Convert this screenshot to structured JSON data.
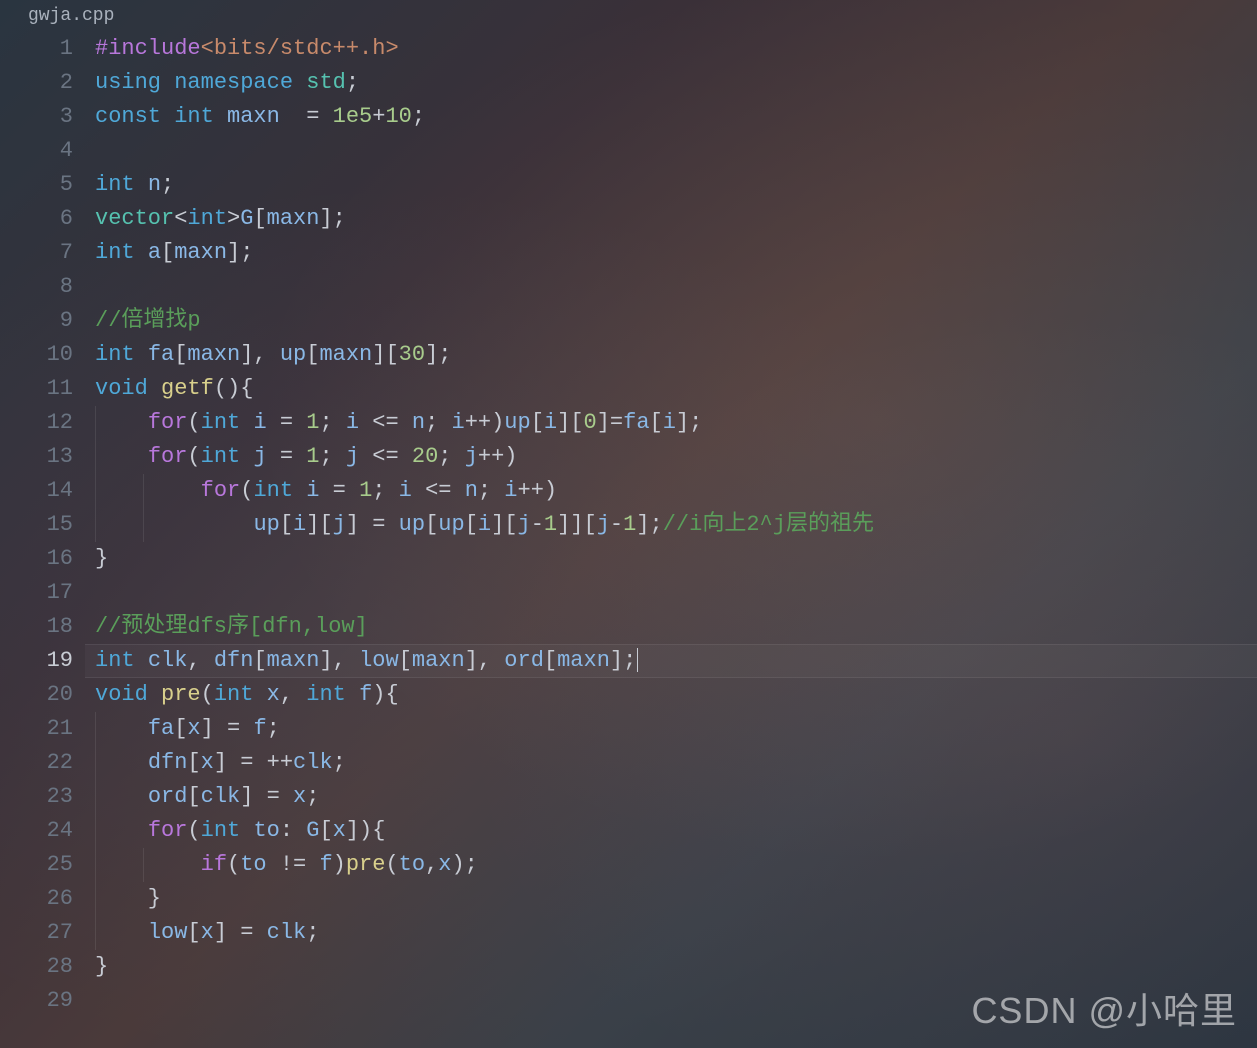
{
  "tab": {
    "filename": "gwja.cpp"
  },
  "active_line": 19,
  "gutter": {
    "start": 1,
    "end": 29
  },
  "code": {
    "lines": [
      [
        {
          "t": "#include",
          "c": "kw-purple"
        },
        {
          "t": "<bits/stdc++.h>",
          "c": "string"
        }
      ],
      [
        {
          "t": "using",
          "c": "kw-blue"
        },
        {
          "t": " ",
          "c": ""
        },
        {
          "t": "namespace",
          "c": "kw-blue"
        },
        {
          "t": " ",
          "c": ""
        },
        {
          "t": "std",
          "c": "kw-teal"
        },
        {
          "t": ";",
          "c": "punct"
        }
      ],
      [
        {
          "t": "const",
          "c": "kw-blue"
        },
        {
          "t": " ",
          "c": ""
        },
        {
          "t": "int",
          "c": "kw-blue"
        },
        {
          "t": " ",
          "c": ""
        },
        {
          "t": "maxn",
          "c": "var"
        },
        {
          "t": "  = ",
          "c": "op"
        },
        {
          "t": "1e5",
          "c": "num-green"
        },
        {
          "t": "+",
          "c": "op"
        },
        {
          "t": "10",
          "c": "num-green"
        },
        {
          "t": ";",
          "c": "punct"
        }
      ],
      [],
      [
        {
          "t": "int",
          "c": "kw-blue"
        },
        {
          "t": " ",
          "c": ""
        },
        {
          "t": "n",
          "c": "var"
        },
        {
          "t": ";",
          "c": "punct"
        }
      ],
      [
        {
          "t": "vector",
          "c": "kw-teal"
        },
        {
          "t": "<",
          "c": "punct"
        },
        {
          "t": "int",
          "c": "kw-blue"
        },
        {
          "t": ">",
          "c": "punct"
        },
        {
          "t": "G",
          "c": "var"
        },
        {
          "t": "[",
          "c": "punct"
        },
        {
          "t": "maxn",
          "c": "var"
        },
        {
          "t": "];",
          "c": "punct"
        }
      ],
      [
        {
          "t": "int",
          "c": "kw-blue"
        },
        {
          "t": " ",
          "c": ""
        },
        {
          "t": "a",
          "c": "var"
        },
        {
          "t": "[",
          "c": "punct"
        },
        {
          "t": "maxn",
          "c": "var"
        },
        {
          "t": "];",
          "c": "punct"
        }
      ],
      [],
      [
        {
          "t": "//倍增找p",
          "c": "comment"
        }
      ],
      [
        {
          "t": "int",
          "c": "kw-blue"
        },
        {
          "t": " ",
          "c": ""
        },
        {
          "t": "fa",
          "c": "var"
        },
        {
          "t": "[",
          "c": "punct"
        },
        {
          "t": "maxn",
          "c": "var"
        },
        {
          "t": "], ",
          "c": "punct"
        },
        {
          "t": "up",
          "c": "var"
        },
        {
          "t": "[",
          "c": "punct"
        },
        {
          "t": "maxn",
          "c": "var"
        },
        {
          "t": "][",
          "c": "punct"
        },
        {
          "t": "30",
          "c": "num-green"
        },
        {
          "t": "];",
          "c": "punct"
        }
      ],
      [
        {
          "t": "void",
          "c": "kw-blue"
        },
        {
          "t": " ",
          "c": ""
        },
        {
          "t": "getf",
          "c": "fn-yellow"
        },
        {
          "t": "(){",
          "c": "punct"
        }
      ],
      [
        {
          "t": "    ",
          "c": ""
        },
        {
          "t": "for",
          "c": "kw-purple"
        },
        {
          "t": "(",
          "c": "punct"
        },
        {
          "t": "int",
          "c": "kw-blue"
        },
        {
          "t": " ",
          "c": ""
        },
        {
          "t": "i",
          "c": "var"
        },
        {
          "t": " = ",
          "c": "op"
        },
        {
          "t": "1",
          "c": "num-green"
        },
        {
          "t": "; ",
          "c": "punct"
        },
        {
          "t": "i",
          "c": "var"
        },
        {
          "t": " <= ",
          "c": "op"
        },
        {
          "t": "n",
          "c": "var"
        },
        {
          "t": "; ",
          "c": "punct"
        },
        {
          "t": "i",
          "c": "var"
        },
        {
          "t": "++)",
          "c": "punct"
        },
        {
          "t": "up",
          "c": "var"
        },
        {
          "t": "[",
          "c": "punct"
        },
        {
          "t": "i",
          "c": "var"
        },
        {
          "t": "][",
          "c": "punct"
        },
        {
          "t": "0",
          "c": "num-green"
        },
        {
          "t": "]=",
          "c": "punct"
        },
        {
          "t": "fa",
          "c": "var"
        },
        {
          "t": "[",
          "c": "punct"
        },
        {
          "t": "i",
          "c": "var"
        },
        {
          "t": "];",
          "c": "punct"
        }
      ],
      [
        {
          "t": "    ",
          "c": ""
        },
        {
          "t": "for",
          "c": "kw-purple"
        },
        {
          "t": "(",
          "c": "punct"
        },
        {
          "t": "int",
          "c": "kw-blue"
        },
        {
          "t": " ",
          "c": ""
        },
        {
          "t": "j",
          "c": "var"
        },
        {
          "t": " = ",
          "c": "op"
        },
        {
          "t": "1",
          "c": "num-green"
        },
        {
          "t": "; ",
          "c": "punct"
        },
        {
          "t": "j",
          "c": "var"
        },
        {
          "t": " <= ",
          "c": "op"
        },
        {
          "t": "20",
          "c": "num-green"
        },
        {
          "t": "; ",
          "c": "punct"
        },
        {
          "t": "j",
          "c": "var"
        },
        {
          "t": "++)",
          "c": "punct"
        }
      ],
      [
        {
          "t": "        ",
          "c": ""
        },
        {
          "t": "for",
          "c": "kw-purple"
        },
        {
          "t": "(",
          "c": "punct"
        },
        {
          "t": "int",
          "c": "kw-blue"
        },
        {
          "t": " ",
          "c": ""
        },
        {
          "t": "i",
          "c": "var"
        },
        {
          "t": " = ",
          "c": "op"
        },
        {
          "t": "1",
          "c": "num-green"
        },
        {
          "t": "; ",
          "c": "punct"
        },
        {
          "t": "i",
          "c": "var"
        },
        {
          "t": " <= ",
          "c": "op"
        },
        {
          "t": "n",
          "c": "var"
        },
        {
          "t": "; ",
          "c": "punct"
        },
        {
          "t": "i",
          "c": "var"
        },
        {
          "t": "++)",
          "c": "punct"
        }
      ],
      [
        {
          "t": "            ",
          "c": ""
        },
        {
          "t": "up",
          "c": "var"
        },
        {
          "t": "[",
          "c": "punct"
        },
        {
          "t": "i",
          "c": "var"
        },
        {
          "t": "][",
          "c": "punct"
        },
        {
          "t": "j",
          "c": "var"
        },
        {
          "t": "] = ",
          "c": "punct"
        },
        {
          "t": "up",
          "c": "var"
        },
        {
          "t": "[",
          "c": "punct"
        },
        {
          "t": "up",
          "c": "var"
        },
        {
          "t": "[",
          "c": "punct"
        },
        {
          "t": "i",
          "c": "var"
        },
        {
          "t": "][",
          "c": "punct"
        },
        {
          "t": "j",
          "c": "var"
        },
        {
          "t": "-",
          "c": "op"
        },
        {
          "t": "1",
          "c": "num-green"
        },
        {
          "t": "]][",
          "c": "punct"
        },
        {
          "t": "j",
          "c": "var"
        },
        {
          "t": "-",
          "c": "op"
        },
        {
          "t": "1",
          "c": "num-green"
        },
        {
          "t": "];",
          "c": "punct"
        },
        {
          "t": "//i向上2^j层的祖先",
          "c": "comment"
        }
      ],
      [
        {
          "t": "}",
          "c": "punct"
        }
      ],
      [],
      [
        {
          "t": "//预处理dfs序[dfn,low]",
          "c": "comment"
        }
      ],
      [
        {
          "t": "int",
          "c": "kw-blue"
        },
        {
          "t": " ",
          "c": ""
        },
        {
          "t": "clk",
          "c": "var"
        },
        {
          "t": ", ",
          "c": "punct"
        },
        {
          "t": "dfn",
          "c": "var"
        },
        {
          "t": "[",
          "c": "punct"
        },
        {
          "t": "maxn",
          "c": "var"
        },
        {
          "t": "], ",
          "c": "punct"
        },
        {
          "t": "low",
          "c": "var"
        },
        {
          "t": "[",
          "c": "punct"
        },
        {
          "t": "maxn",
          "c": "var"
        },
        {
          "t": "], ",
          "c": "punct"
        },
        {
          "t": "ord",
          "c": "var"
        },
        {
          "t": "[",
          "c": "punct"
        },
        {
          "t": "maxn",
          "c": "var"
        },
        {
          "t": "];",
          "c": "punct"
        }
      ],
      [
        {
          "t": "void",
          "c": "kw-blue"
        },
        {
          "t": " ",
          "c": ""
        },
        {
          "t": "pre",
          "c": "fn-yellow"
        },
        {
          "t": "(",
          "c": "punct"
        },
        {
          "t": "int",
          "c": "kw-blue"
        },
        {
          "t": " ",
          "c": ""
        },
        {
          "t": "x",
          "c": "var"
        },
        {
          "t": ", ",
          "c": "punct"
        },
        {
          "t": "int",
          "c": "kw-blue"
        },
        {
          "t": " ",
          "c": ""
        },
        {
          "t": "f",
          "c": "var"
        },
        {
          "t": "){",
          "c": "punct"
        }
      ],
      [
        {
          "t": "    ",
          "c": ""
        },
        {
          "t": "fa",
          "c": "var"
        },
        {
          "t": "[",
          "c": "punct"
        },
        {
          "t": "x",
          "c": "var"
        },
        {
          "t": "] = ",
          "c": "punct"
        },
        {
          "t": "f",
          "c": "var"
        },
        {
          "t": ";",
          "c": "punct"
        }
      ],
      [
        {
          "t": "    ",
          "c": ""
        },
        {
          "t": "dfn",
          "c": "var"
        },
        {
          "t": "[",
          "c": "punct"
        },
        {
          "t": "x",
          "c": "var"
        },
        {
          "t": "] = ++",
          "c": "punct"
        },
        {
          "t": "clk",
          "c": "var"
        },
        {
          "t": ";",
          "c": "punct"
        }
      ],
      [
        {
          "t": "    ",
          "c": ""
        },
        {
          "t": "ord",
          "c": "var"
        },
        {
          "t": "[",
          "c": "punct"
        },
        {
          "t": "clk",
          "c": "var"
        },
        {
          "t": "] = ",
          "c": "punct"
        },
        {
          "t": "x",
          "c": "var"
        },
        {
          "t": ";",
          "c": "punct"
        }
      ],
      [
        {
          "t": "    ",
          "c": ""
        },
        {
          "t": "for",
          "c": "kw-purple"
        },
        {
          "t": "(",
          "c": "punct"
        },
        {
          "t": "int",
          "c": "kw-blue"
        },
        {
          "t": " ",
          "c": ""
        },
        {
          "t": "to",
          "c": "var"
        },
        {
          "t": ": ",
          "c": "punct"
        },
        {
          "t": "G",
          "c": "var"
        },
        {
          "t": "[",
          "c": "punct"
        },
        {
          "t": "x",
          "c": "var"
        },
        {
          "t": "]){",
          "c": "punct"
        }
      ],
      [
        {
          "t": "        ",
          "c": ""
        },
        {
          "t": "if",
          "c": "kw-purple"
        },
        {
          "t": "(",
          "c": "punct"
        },
        {
          "t": "to",
          "c": "var"
        },
        {
          "t": " != ",
          "c": "op"
        },
        {
          "t": "f",
          "c": "var"
        },
        {
          "t": ")",
          "c": "punct"
        },
        {
          "t": "pre",
          "c": "fn-yellow"
        },
        {
          "t": "(",
          "c": "punct"
        },
        {
          "t": "to",
          "c": "var"
        },
        {
          "t": ",",
          "c": "punct"
        },
        {
          "t": "x",
          "c": "var"
        },
        {
          "t": ");",
          "c": "punct"
        }
      ],
      [
        {
          "t": "    }",
          "c": "punct"
        }
      ],
      [
        {
          "t": "    ",
          "c": ""
        },
        {
          "t": "low",
          "c": "var"
        },
        {
          "t": "[",
          "c": "punct"
        },
        {
          "t": "x",
          "c": "var"
        },
        {
          "t": "] = ",
          "c": "punct"
        },
        {
          "t": "clk",
          "c": "var"
        },
        {
          "t": ";",
          "c": "punct"
        }
      ],
      [
        {
          "t": "}",
          "c": "punct"
        }
      ],
      []
    ]
  },
  "watermark": "CSDN @小哈里"
}
